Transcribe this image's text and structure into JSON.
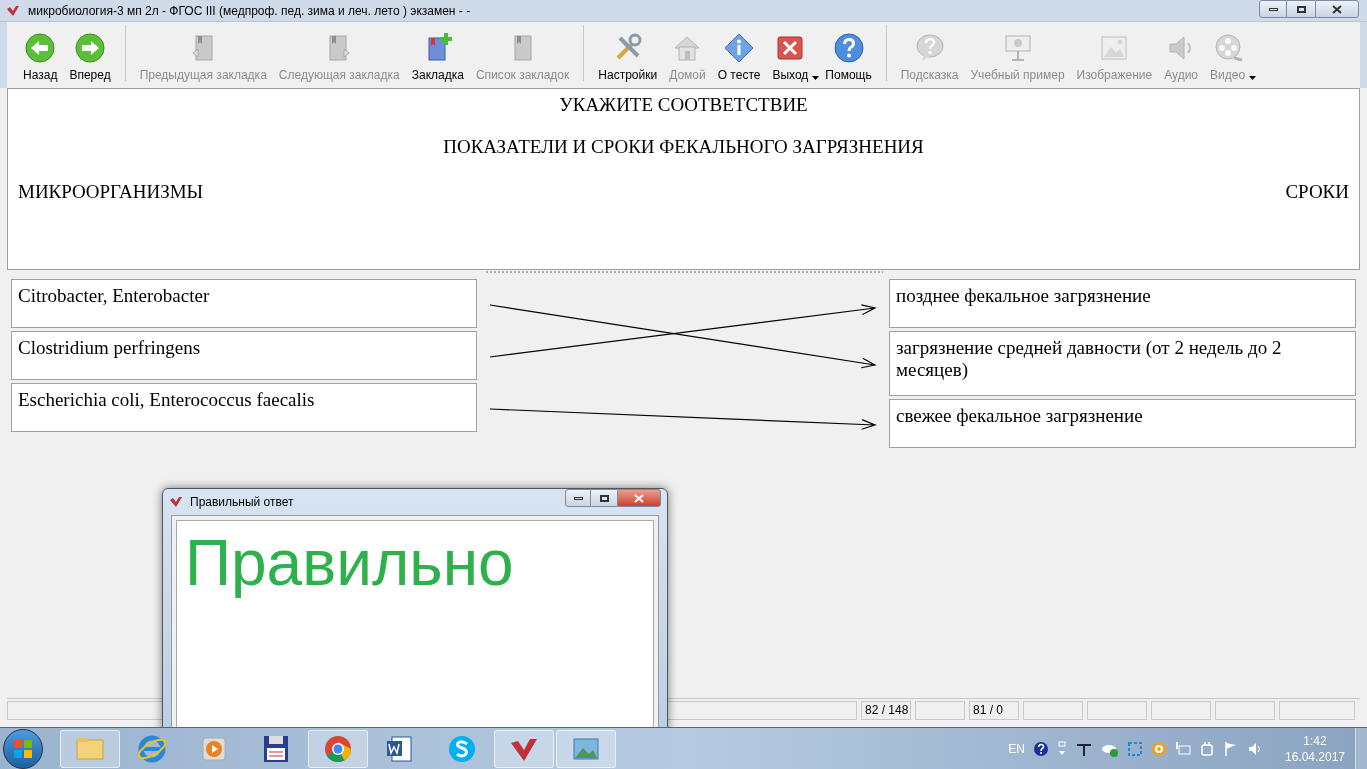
{
  "window": {
    "title": "микробиология-3 мп 2л - ФГОС III (медпроф. пед. зима и леч. лето ) экзамен -  -"
  },
  "toolbar": {
    "groups": [
      [
        {
          "label": "Назад",
          "kind": "back",
          "disabled": false
        },
        {
          "label": "Вперед",
          "kind": "forward",
          "disabled": false
        }
      ],
      [
        {
          "label": "Предыдущая закладка",
          "kind": "bookmark-prev",
          "disabled": true
        },
        {
          "label": "Следующая закладка",
          "kind": "bookmark-next",
          "disabled": true
        },
        {
          "label": "Закладка",
          "kind": "bookmark-add",
          "disabled": false
        },
        {
          "label": "Список закладок",
          "kind": "bookmark-list",
          "disabled": true
        }
      ],
      [
        {
          "label": "Настройки",
          "kind": "tools",
          "disabled": false
        },
        {
          "label": "Домой",
          "kind": "home",
          "disabled": true
        },
        {
          "label": "О тесте",
          "kind": "info",
          "disabled": false
        },
        {
          "label": "Выход",
          "kind": "exit",
          "disabled": false,
          "dropdown": true
        },
        {
          "label": "Помощь",
          "kind": "help",
          "disabled": false
        }
      ],
      [
        {
          "label": "Подсказка",
          "kind": "hint",
          "disabled": true
        },
        {
          "label": "Учебный пример",
          "kind": "presentation",
          "disabled": true
        },
        {
          "label": "Изображение",
          "kind": "image",
          "disabled": true
        },
        {
          "label": "Аудио",
          "kind": "audio",
          "disabled": true
        },
        {
          "label": "Видео",
          "kind": "video",
          "disabled": true,
          "dropdown": true
        }
      ]
    ]
  },
  "question": {
    "instruction": "УКАЖИТЕ СООТВЕТСТВИЕ",
    "title": "ПОКАЗАТЕЛИ И СРОКИ ФЕКАЛЬНОГО ЗАГРЯЗНЕНИЯ",
    "left_heading": "МИКРООРГАНИЗМЫ",
    "right_heading": "СРОКИ"
  },
  "matching": {
    "left": [
      {
        "text": "Citrobacter, Enterobacter",
        "kind": "to-middle"
      },
      {
        "text": "Clostridium perfringens",
        "kind": "to-top"
      },
      {
        "text": "Escherichia coli, Enterococcus faecalis",
        "kind": "to-bottom"
      }
    ],
    "right": [
      {
        "text": "позднее фекальное загрязнение"
      },
      {
        "text": "загрязнение средней давности (от 2 недель до 2 месяцев)"
      },
      {
        "text": "свежее фекальное загрязнение"
      }
    ]
  },
  "status_bar": [
    "82 / 148",
    "81 / 0"
  ],
  "dialog": {
    "title": "Правильный ответ",
    "message": "Правильно"
  },
  "taskbar": {
    "apps": [
      {
        "kind": "folder",
        "running": true
      },
      {
        "kind": "browser-e",
        "running": false
      },
      {
        "kind": "player",
        "running": false
      },
      {
        "kind": "floppy",
        "running": false
      },
      {
        "kind": "chrome",
        "running": true
      },
      {
        "kind": "word",
        "running": false
      },
      {
        "kind": "skype",
        "running": false
      },
      {
        "kind": "check",
        "running": true
      },
      {
        "kind": "photo",
        "running": true
      }
    ],
    "language": "EN",
    "time": "1:42",
    "date": "16.04.2017"
  }
}
